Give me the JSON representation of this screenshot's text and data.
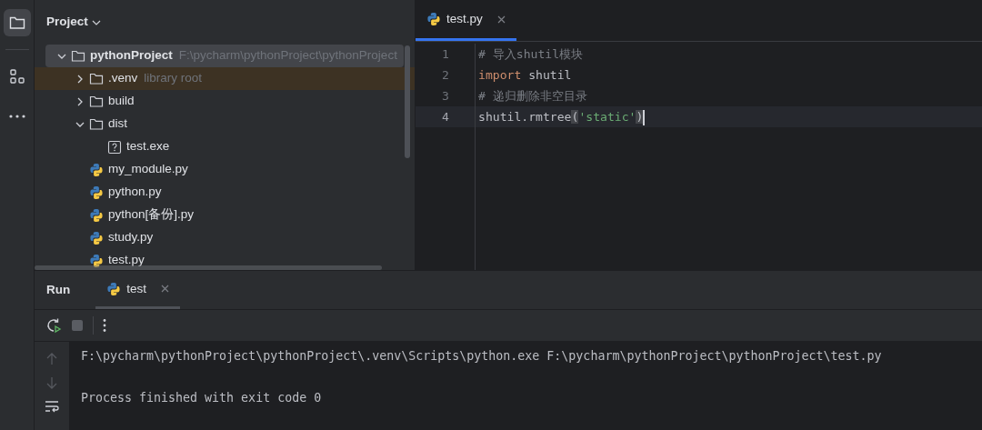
{
  "project_panel": {
    "title": "Project",
    "tree": [
      {
        "label": "pythonProject",
        "hint": "F:\\pycharm\\pythonProject\\pythonProject",
        "kind": "folder",
        "expanded": true,
        "selected": true,
        "highlighted": false,
        "children": [
          {
            "label": ".venv",
            "hint": "library root",
            "kind": "folder",
            "expanded": false,
            "selected": false,
            "highlighted": true
          },
          {
            "label": "build",
            "kind": "folder",
            "expanded": false,
            "selected": false,
            "highlighted": false
          },
          {
            "label": "dist",
            "kind": "folder",
            "expanded": true,
            "selected": false,
            "highlighted": false,
            "children": [
              {
                "label": "test.exe",
                "kind": "unknown",
                "selected": false,
                "highlighted": false
              }
            ]
          },
          {
            "label": "my_module.py",
            "kind": "python",
            "selected": false,
            "highlighted": false
          },
          {
            "label": "python.py",
            "kind": "python",
            "selected": false,
            "highlighted": false
          },
          {
            "label": "python[备份].py",
            "kind": "python",
            "selected": false,
            "highlighted": false
          },
          {
            "label": "study.py",
            "kind": "python",
            "selected": false,
            "highlighted": false
          },
          {
            "label": "test.py",
            "kind": "python",
            "selected": false,
            "highlighted": false
          }
        ]
      }
    ]
  },
  "editor": {
    "tabs": [
      {
        "label": "test.py",
        "selected": true
      }
    ],
    "lines": [
      {
        "number": "1",
        "current": false,
        "cursor": false,
        "tokens": [
          {
            "kind": "comment",
            "text": "# 导入shutil模块"
          }
        ]
      },
      {
        "number": "2",
        "current": false,
        "cursor": false,
        "tokens": [
          {
            "kind": "keyword",
            "text": "import"
          },
          {
            "kind": "plain",
            "text": " shutil"
          }
        ]
      },
      {
        "number": "3",
        "current": false,
        "cursor": false,
        "tokens": [
          {
            "kind": "comment",
            "text": "# 递归删除非空目录"
          }
        ]
      },
      {
        "number": "4",
        "current": true,
        "cursor": true,
        "tokens": [
          {
            "kind": "plain",
            "text": "shutil.rmtree"
          },
          {
            "kind": "bracket",
            "text": "("
          },
          {
            "kind": "string",
            "text": "'static'"
          },
          {
            "kind": "bracket",
            "text": ")"
          }
        ]
      }
    ]
  },
  "run_panel": {
    "title": "Run",
    "tabs": [
      {
        "label": "test",
        "selected": true
      }
    ],
    "console": [
      {
        "text": "F:\\pycharm\\pythonProject\\pythonProject\\.venv\\Scripts\\python.exe F:\\pycharm\\pythonProject\\pythonProject\\test.py"
      },
      {
        "text": "Process finished with exit code 0"
      }
    ]
  }
}
